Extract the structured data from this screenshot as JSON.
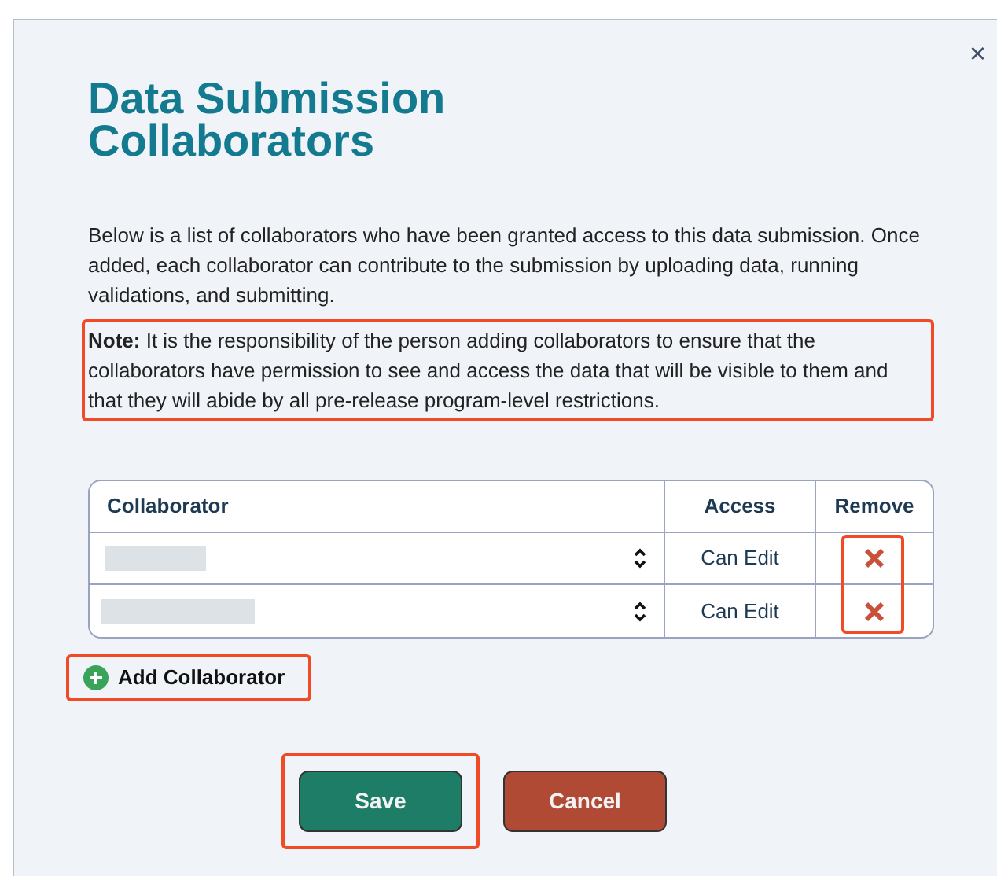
{
  "dialog": {
    "close_label": "×",
    "title": "Data Submission Collaborators",
    "description": "Below is a list of collaborators who have been granted access to this data submission. Once added, each collaborator can contribute to the submission by uploading data, running validations, and submitting.",
    "note": {
      "text": "**Note:** It is the responsibility of the person adding collaborators to ensure that the collaborators have permission to see and access the data that will be visible to them and that they will abide by all pre-release program-level restrictions.",
      "highlighted": true
    },
    "table": {
      "columns": [
        "Collaborator",
        "Access",
        "Remove"
      ],
      "remove_highlighted": true,
      "rows": [
        {
          "name_redacted": true,
          "access": "Can Edit"
        },
        {
          "name_redacted": true,
          "access": "Can Edit"
        }
      ]
    },
    "add_button": {
      "label": "Add Collaborator",
      "highlighted": true
    },
    "buttons": [
      {
        "label": "Save",
        "kind": "primary",
        "highlighted": true
      },
      {
        "label": "Cancel",
        "kind": "danger",
        "highlighted": false
      }
    ]
  }
}
